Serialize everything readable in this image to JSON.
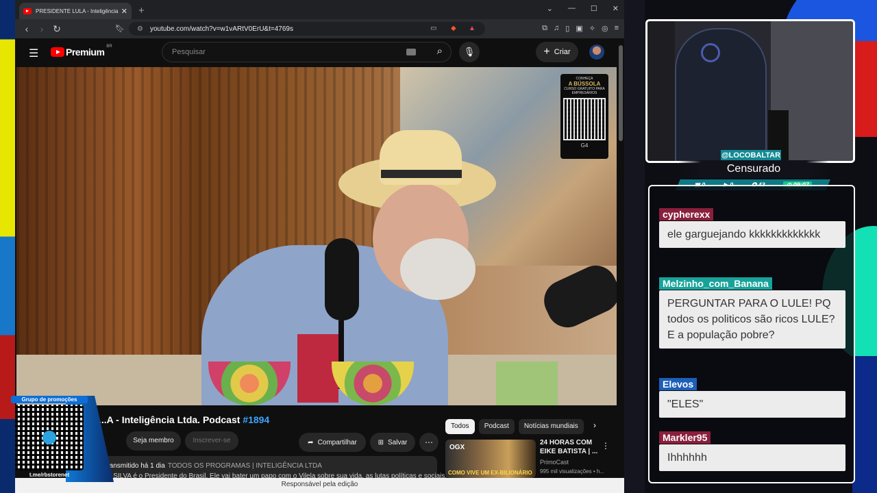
{
  "browser": {
    "tab_title": "PRESIDENTE LULA - Inteligência Ltd...",
    "url": "youtube.com/watch?v=w1vARtV0ErU&t=4769s"
  },
  "youtube": {
    "logo_text": "Premium",
    "region": "BR",
    "search_placeholder": "Pesquisar",
    "create_label": "Criar"
  },
  "video": {
    "overlay": {
      "line1": "CONHEÇA",
      "line2": "A BÚSSOLA",
      "line3": "CURSO GRATUITO PARA EMPRESÁRIOS",
      "brand": "G4"
    },
    "title_main": "...A - Inteligência Ltda. Podcast",
    "title_hash": "#1894",
    "join_label": "Seja membro",
    "subscribe_label": "Inscrever-se",
    "share_label": "Compartilhar",
    "save_label": "Salvar",
    "meta": "...ransmitido há 1 dia",
    "tags": "TODOS OS PROGRAMAS | INTELIGÊNCIA LTDA",
    "description": "...A SILVA é o Presidente do Brasil. Ele vai bater um papo com o Vilela sobre sua vida, as lutas políticas e sociais, a"
  },
  "chips": [
    "Todos",
    "Podcast",
    "Notícias mundiais"
  ],
  "recommendation": {
    "title": "24 HORAS COM EIKE BATISTA | ...",
    "channel": "PrimoCast",
    "views": "995 mil visualizações • h...",
    "thumb_brand": "OGX",
    "thumb_caption": "COMO VIVE UM EX-BILIONÁRIO"
  },
  "status_bar": "Responsável pela edição",
  "promo": {
    "caption": "Grupo de promoções",
    "link": "t.me/rbstorenet"
  },
  "stream": {
    "handle": "@LOCOBALTAR",
    "status": "Censurado",
    "stats": {
      "a": "0",
      "b": "0",
      "c": "43",
      "time": "09:07"
    }
  },
  "chat": [
    {
      "user": "cypherexx",
      "color": "#8a1f3c",
      "text": "ele garguejando kkkkkkkkkkkkk"
    },
    {
      "user": "Melzinho_com_Banana",
      "color": "#18a39a",
      "text": "PERGUNTAR PARA O LULE! PQ todos os politicos são ricos LULE? E a população pobre?"
    },
    {
      "user": "Elevos",
      "color": "#1c5fb8",
      "text": "\"ELES\""
    },
    {
      "user": "Markler95",
      "color": "#8a1f3c",
      "text": "Ihhhhhh"
    }
  ]
}
